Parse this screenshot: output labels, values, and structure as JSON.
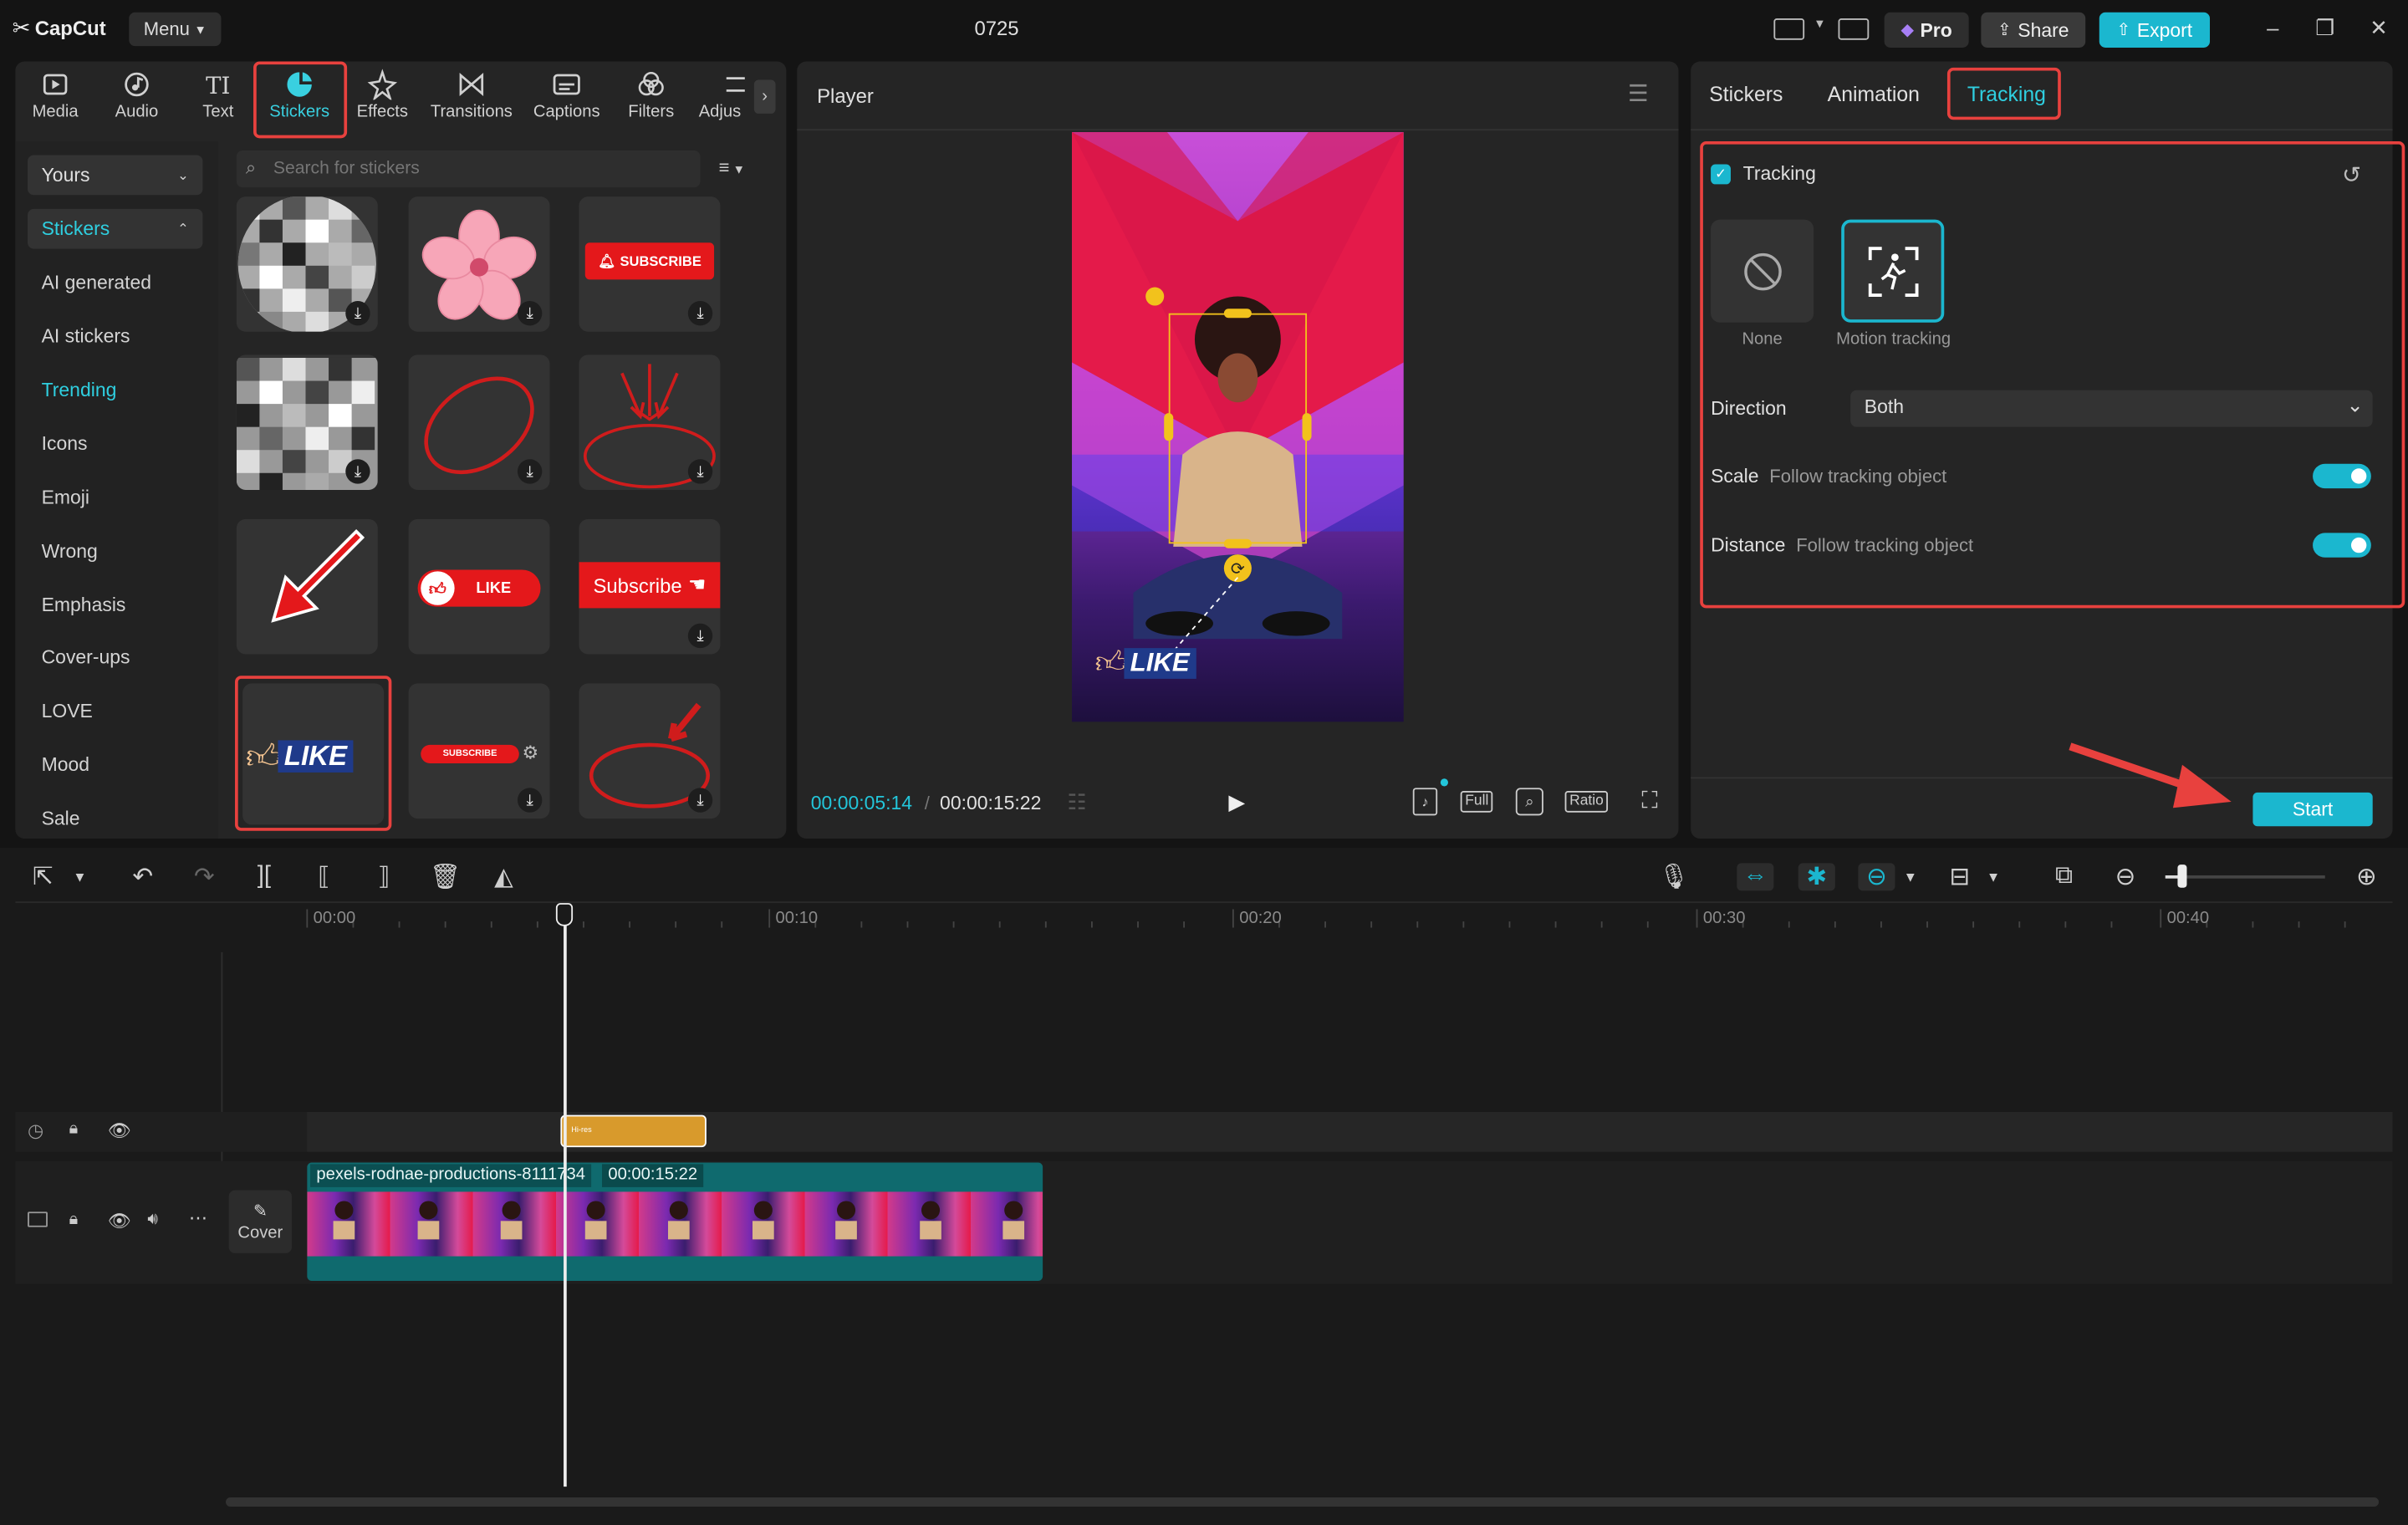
{
  "app": {
    "name": "CapCut",
    "project_title": "0725",
    "menu_label": "Menu"
  },
  "titlebar": {
    "pro_label": "Pro",
    "share_label": "Share",
    "export_label": "Export"
  },
  "tools": [
    {
      "label": "Media",
      "icon": "media-icon"
    },
    {
      "label": "Audio",
      "icon": "audio-icon"
    },
    {
      "label": "Text",
      "icon": "text-icon"
    },
    {
      "label": "Stickers",
      "icon": "stickers-icon",
      "active": true
    },
    {
      "label": "Effects",
      "icon": "effects-icon"
    },
    {
      "label": "Transitions",
      "icon": "transitions-icon"
    },
    {
      "label": "Captions",
      "icon": "captions-icon"
    },
    {
      "label": "Filters",
      "icon": "filters-icon"
    },
    {
      "label": "Adjus",
      "icon": "adjust-icon"
    }
  ],
  "sidebar": {
    "yours": "Yours",
    "stickers": "Stickers",
    "items": [
      "AI generated",
      "AI stickers",
      "Trending",
      "Icons",
      "Emoji",
      "Wrong",
      "Emphasis",
      "Cover-ups",
      "LOVE",
      "Mood",
      "Sale"
    ],
    "active_item": "Trending"
  },
  "search": {
    "placeholder": "Search for stickers"
  },
  "stickers": {
    "subscribe_small": "SUBSCRIBE",
    "like_small": "LIKE",
    "subscribe_text": "Subscribe",
    "like_big": "LIKE",
    "subscribe_tiny": "SUBSCRIBE"
  },
  "player": {
    "title": "Player",
    "current_time": "00:00:05:14",
    "total_time": "00:00:15:22",
    "full_label": "Full",
    "ratio_label": "Ratio",
    "sticker_text": "LIKE"
  },
  "right_panel": {
    "tabs": [
      "Stickers",
      "Animation",
      "Tracking"
    ],
    "active_tab": "Tracking",
    "tracking_label": "Tracking",
    "tracking_checked": true,
    "options": [
      {
        "label": "None"
      },
      {
        "label": "Motion tracking",
        "selected": true
      }
    ],
    "direction_label": "Direction",
    "direction_value": "Both",
    "scale_label": "Scale",
    "scale_sub": "Follow tracking object",
    "scale_on": true,
    "distance_label": "Distance",
    "distance_sub": "Follow tracking object",
    "distance_on": true,
    "start_label": "Start"
  },
  "timeline": {
    "ticks": [
      "00:00",
      "00:10",
      "00:20",
      "00:30",
      "00:40"
    ],
    "clip_name": "pexels-rodnae-productions-8111734",
    "clip_duration": "00:00:15:22",
    "cover_label": "Cover",
    "sticker_clip_label": "Hi-res"
  },
  "colors": {
    "accent": "#1bb7cf",
    "highlight": "#e8413e",
    "sticker_clip": "#d89a2c",
    "video_track": "#0f6a6e"
  }
}
